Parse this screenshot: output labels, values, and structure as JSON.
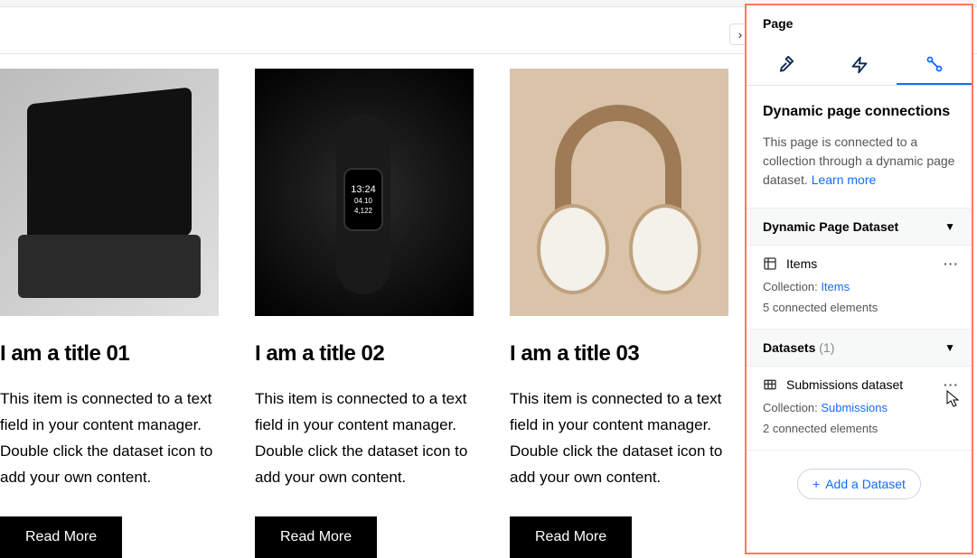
{
  "cards": [
    {
      "title": "I am a title 01",
      "desc": "This item is connected to a text field in your content manager. Double click the dataset icon to add your own content.",
      "button": "Read More",
      "watch": {
        "time": "13:24",
        "date": "04.10",
        "steps": "4,122"
      }
    },
    {
      "title": "I am a title 02",
      "desc": "This item is connected to a text field in your content manager. Double click the dataset icon to add your own content.",
      "button": "Read More"
    },
    {
      "title": "I am a title 03",
      "desc": "This item is connected to a text field in your content manager. Double click the dataset icon to add your own content.",
      "button": "Read More"
    }
  ],
  "panel": {
    "header": "Page",
    "section_title": "Dynamic page connections",
    "section_desc": "This page is connected to a collection through a dynamic page dataset. ",
    "learn_more": "Learn more",
    "group1": {
      "title": "Dynamic Page Dataset"
    },
    "dataset1": {
      "name": "Items",
      "collection_label": "Collection: ",
      "collection_link": "Items",
      "connected": "5 connected elements"
    },
    "group2": {
      "title": "Datasets",
      "count": "(1)"
    },
    "dataset2": {
      "name": "Submissions dataset",
      "collection_label": "Collection: ",
      "collection_link": "Submissions",
      "connected": "2 connected elements"
    },
    "add_button": "Add a Dataset"
  }
}
